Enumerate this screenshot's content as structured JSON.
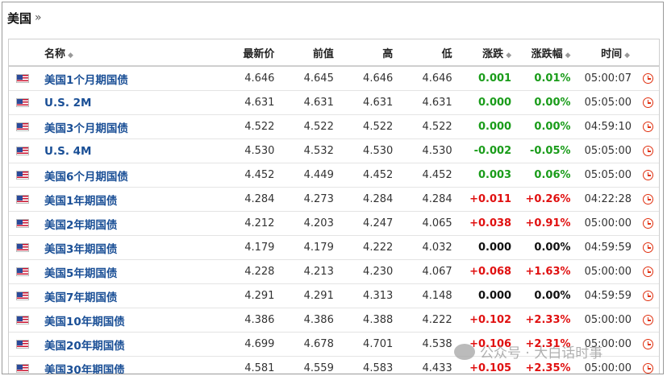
{
  "title": "美国",
  "title_arrow": "»",
  "columns": {
    "name": "名称",
    "latest": "最新价",
    "prev": "前值",
    "high": "高",
    "low": "低",
    "change": "涨跌",
    "change_pct": "涨跌幅",
    "time": "时间"
  },
  "sort_glyph": "◆",
  "rows": [
    {
      "name": "美国1个月期国债",
      "latest": "4.646",
      "prev": "4.645",
      "high": "4.646",
      "low": "4.646",
      "change": "0.001",
      "change_pct": "0.01%",
      "time": "05:00:07",
      "dir": "green"
    },
    {
      "name": "U.S. 2M",
      "latest": "4.631",
      "prev": "4.631",
      "high": "4.631",
      "low": "4.631",
      "change": "0.000",
      "change_pct": "0.00%",
      "time": "05:05:00",
      "dir": "green"
    },
    {
      "name": "美国3个月期国债",
      "latest": "4.522",
      "prev": "4.522",
      "high": "4.522",
      "low": "4.522",
      "change": "0.000",
      "change_pct": "0.00%",
      "time": "04:59:10",
      "dir": "green"
    },
    {
      "name": "U.S. 4M",
      "latest": "4.530",
      "prev": "4.532",
      "high": "4.530",
      "low": "4.530",
      "change": "-0.002",
      "change_pct": "-0.05%",
      "time": "05:05:00",
      "dir": "green"
    },
    {
      "name": "美国6个月期国债",
      "latest": "4.452",
      "prev": "4.449",
      "high": "4.452",
      "low": "4.452",
      "change": "0.003",
      "change_pct": "0.06%",
      "time": "05:05:00",
      "dir": "green"
    },
    {
      "name": "美国1年期国债",
      "latest": "4.284",
      "prev": "4.273",
      "high": "4.284",
      "low": "4.284",
      "change": "+0.011",
      "change_pct": "+0.26%",
      "time": "04:22:28",
      "dir": "red"
    },
    {
      "name": "美国2年期国债",
      "latest": "4.212",
      "prev": "4.203",
      "high": "4.247",
      "low": "4.065",
      "change": "+0.038",
      "change_pct": "+0.91%",
      "time": "05:00:00",
      "dir": "red"
    },
    {
      "name": "美国3年期国债",
      "latest": "4.179",
      "prev": "4.179",
      "high": "4.222",
      "low": "4.032",
      "change": "0.000",
      "change_pct": "0.00%",
      "time": "04:59:59",
      "dir": "zero"
    },
    {
      "name": "美国5年期国债",
      "latest": "4.228",
      "prev": "4.213",
      "high": "4.230",
      "low": "4.067",
      "change": "+0.068",
      "change_pct": "+1.63%",
      "time": "05:00:00",
      "dir": "red"
    },
    {
      "name": "美国7年期国债",
      "latest": "4.291",
      "prev": "4.291",
      "high": "4.313",
      "low": "4.148",
      "change": "0.000",
      "change_pct": "0.00%",
      "time": "04:59:59",
      "dir": "zero"
    },
    {
      "name": "美国10年期国债",
      "latest": "4.386",
      "prev": "4.386",
      "high": "4.388",
      "low": "4.222",
      "change": "+0.102",
      "change_pct": "+2.33%",
      "time": "05:00:00",
      "dir": "red"
    },
    {
      "name": "美国20年期国债",
      "latest": "4.699",
      "prev": "4.678",
      "high": "4.701",
      "low": "4.538",
      "change": "+0.106",
      "change_pct": "+2.31%",
      "time": "05:00:00",
      "dir": "red"
    },
    {
      "name": "美国30年期国债",
      "latest": "4.581",
      "prev": "4.559",
      "high": "4.583",
      "low": "4.433",
      "change": "+0.105",
      "change_pct": "+2.35%",
      "time": "05:00:00",
      "dir": "red"
    }
  ],
  "watermark": "公众号 · 大白话时事",
  "colors": {
    "green": "#1a9c1a",
    "red": "#e01010",
    "link": "#1a4f96",
    "clock": "#e03010"
  },
  "icons": {
    "flag": "us-flag-icon",
    "clock": "clock-icon"
  }
}
